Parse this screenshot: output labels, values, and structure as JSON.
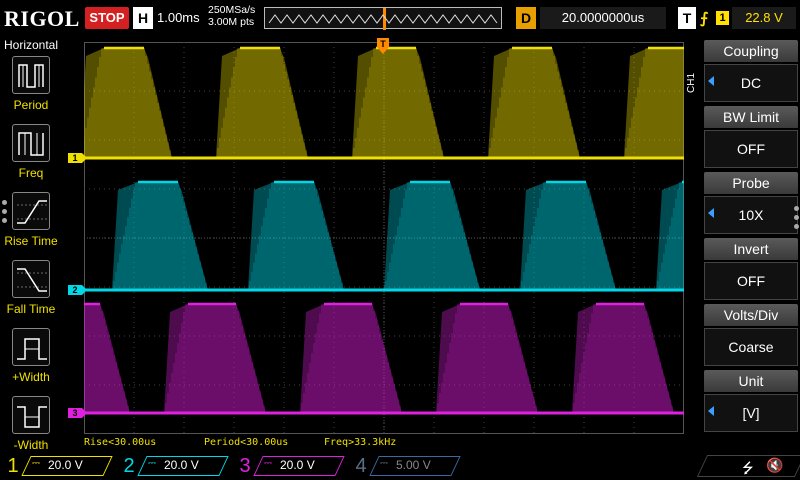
{
  "top": {
    "brand": "RIGOL",
    "run_state": "STOP",
    "horizontal_badge": "H",
    "timebase": "1.00ms",
    "sample_rate": "250MSa/s",
    "memory_depth": "3.00M pts",
    "delay_badge": "D",
    "delay": "20.0000000us",
    "trigger_badge": "T",
    "trigger_edge": "⨍",
    "trigger_source": "1",
    "trigger_level": "22.8 V"
  },
  "left": {
    "title": "Horizontal",
    "items": [
      {
        "label": "Period",
        "icon": "period-icon"
      },
      {
        "label": "Freq",
        "icon": "frequency-icon"
      },
      {
        "label": "Rise Time",
        "icon": "rise-time-icon"
      },
      {
        "label": "Fall Time",
        "icon": "fall-time-icon"
      },
      {
        "label": "+Width",
        "icon": "positive-width-icon"
      },
      {
        "label": "-Width",
        "icon": "negative-width-icon"
      }
    ]
  },
  "right": {
    "channel_tab": "CH1",
    "menu": [
      {
        "title": "Coupling",
        "value": "DC",
        "has_arrow": true
      },
      {
        "title": "BW Limit",
        "value": "OFF",
        "has_arrow": false
      },
      {
        "title": "Probe",
        "value": "10X",
        "has_arrow": true
      },
      {
        "title": "Invert",
        "value": "OFF",
        "has_arrow": false
      },
      {
        "title": "Volts/Div",
        "value": "Coarse",
        "has_arrow": false
      },
      {
        "title": "Unit",
        "value": "[V]",
        "has_arrow": true
      }
    ]
  },
  "measurements": {
    "rise": "Rise<30.00us",
    "period": "Period<30.00us",
    "freq": "Freq>33.3kHz"
  },
  "markers": {
    "ch1": "1",
    "ch2": "2",
    "ch3": "3",
    "trigger": "T"
  },
  "channels": [
    {
      "num": "1",
      "volts": "20.0 V",
      "color": "#f0e000",
      "active": true
    },
    {
      "num": "2",
      "volts": "20.0 V",
      "color": "#00d8e8",
      "active": true
    },
    {
      "num": "3",
      "volts": "20.0 V",
      "color": "#e020e0",
      "active": true
    },
    {
      "num": "4",
      "volts": "5.00 V",
      "color": "#3a6aa0",
      "active": false
    }
  ],
  "status": {
    "usb": "⭍",
    "speaker": "🔇"
  },
  "colors": {
    "ch1": "#f0e000",
    "ch2": "#00d8e8",
    "ch3": "#e020e0",
    "ch4": "#3a6aa0",
    "trigger": "#ff8a00",
    "stop": "#d42020"
  }
}
